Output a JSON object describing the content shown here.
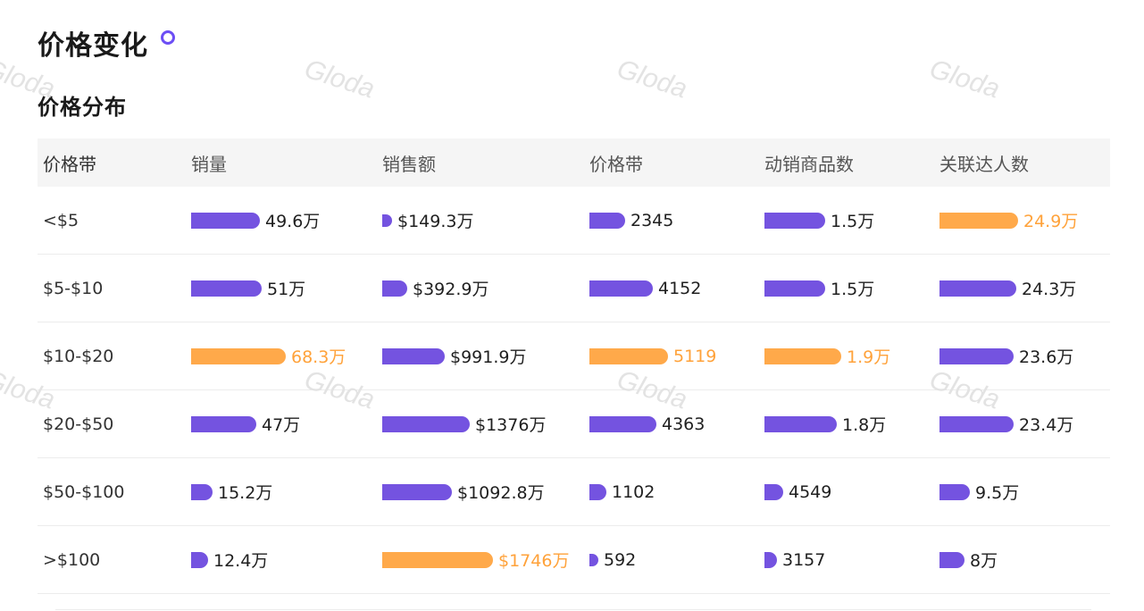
{
  "page": {
    "title": "价格变化",
    "subtitle": "价格分布",
    "watermark": "Gloda"
  },
  "colors": {
    "bar_default": "#7453e0",
    "bar_highlight": "#ffa94a",
    "text_highlight": "#ffa23a"
  },
  "table": {
    "headers": [
      "价格带",
      "销量",
      "销售额",
      "价格带",
      "动销商品数",
      "关联达人数"
    ],
    "rows": [
      {
        "band": "<$5",
        "cells": [
          {
            "label": "49.6万",
            "value": 496000,
            "highlight": false
          },
          {
            "label": "$149.3万",
            "value": 1493000,
            "highlight": false
          },
          {
            "label": "2345",
            "value": 2345,
            "highlight": false
          },
          {
            "label": "1.5万",
            "value": 15000,
            "highlight": false
          },
          {
            "label": "24.9万",
            "value": 249000,
            "highlight": true
          }
        ]
      },
      {
        "band": "$5-$10",
        "cells": [
          {
            "label": "51万",
            "value": 510000,
            "highlight": false
          },
          {
            "label": "$392.9万",
            "value": 3929000,
            "highlight": false
          },
          {
            "label": "4152",
            "value": 4152,
            "highlight": false
          },
          {
            "label": "1.5万",
            "value": 15000,
            "highlight": false
          },
          {
            "label": "24.3万",
            "value": 243000,
            "highlight": false
          }
        ]
      },
      {
        "band": "$10-$20",
        "cells": [
          {
            "label": "68.3万",
            "value": 683000,
            "highlight": true
          },
          {
            "label": "$991.9万",
            "value": 9919000,
            "highlight": false
          },
          {
            "label": "5119",
            "value": 5119,
            "highlight": true
          },
          {
            "label": "1.9万",
            "value": 19000,
            "highlight": true
          },
          {
            "label": "23.6万",
            "value": 236000,
            "highlight": false
          }
        ]
      },
      {
        "band": "$20-$50",
        "cells": [
          {
            "label": "47万",
            "value": 470000,
            "highlight": false
          },
          {
            "label": "$1376万",
            "value": 13760000,
            "highlight": false
          },
          {
            "label": "4363",
            "value": 4363,
            "highlight": false
          },
          {
            "label": "1.8万",
            "value": 18000,
            "highlight": false
          },
          {
            "label": "23.4万",
            "value": 234000,
            "highlight": false
          }
        ]
      },
      {
        "band": "$50-$100",
        "cells": [
          {
            "label": "15.2万",
            "value": 152000,
            "highlight": false
          },
          {
            "label": "$1092.8万",
            "value": 10928000,
            "highlight": false
          },
          {
            "label": "1102",
            "value": 1102,
            "highlight": false
          },
          {
            "label": "4549",
            "value": 4549,
            "highlight": false
          },
          {
            "label": "9.5万",
            "value": 95000,
            "highlight": false
          }
        ]
      },
      {
        "band": ">$100",
        "cells": [
          {
            "label": "12.4万",
            "value": 124000,
            "highlight": false
          },
          {
            "label": "$1746万",
            "value": 17460000,
            "highlight": true
          },
          {
            "label": "592",
            "value": 592,
            "highlight": false
          },
          {
            "label": "3157",
            "value": 3157,
            "highlight": false
          },
          {
            "label": "8万",
            "value": 80000,
            "highlight": false
          }
        ]
      }
    ]
  }
}
